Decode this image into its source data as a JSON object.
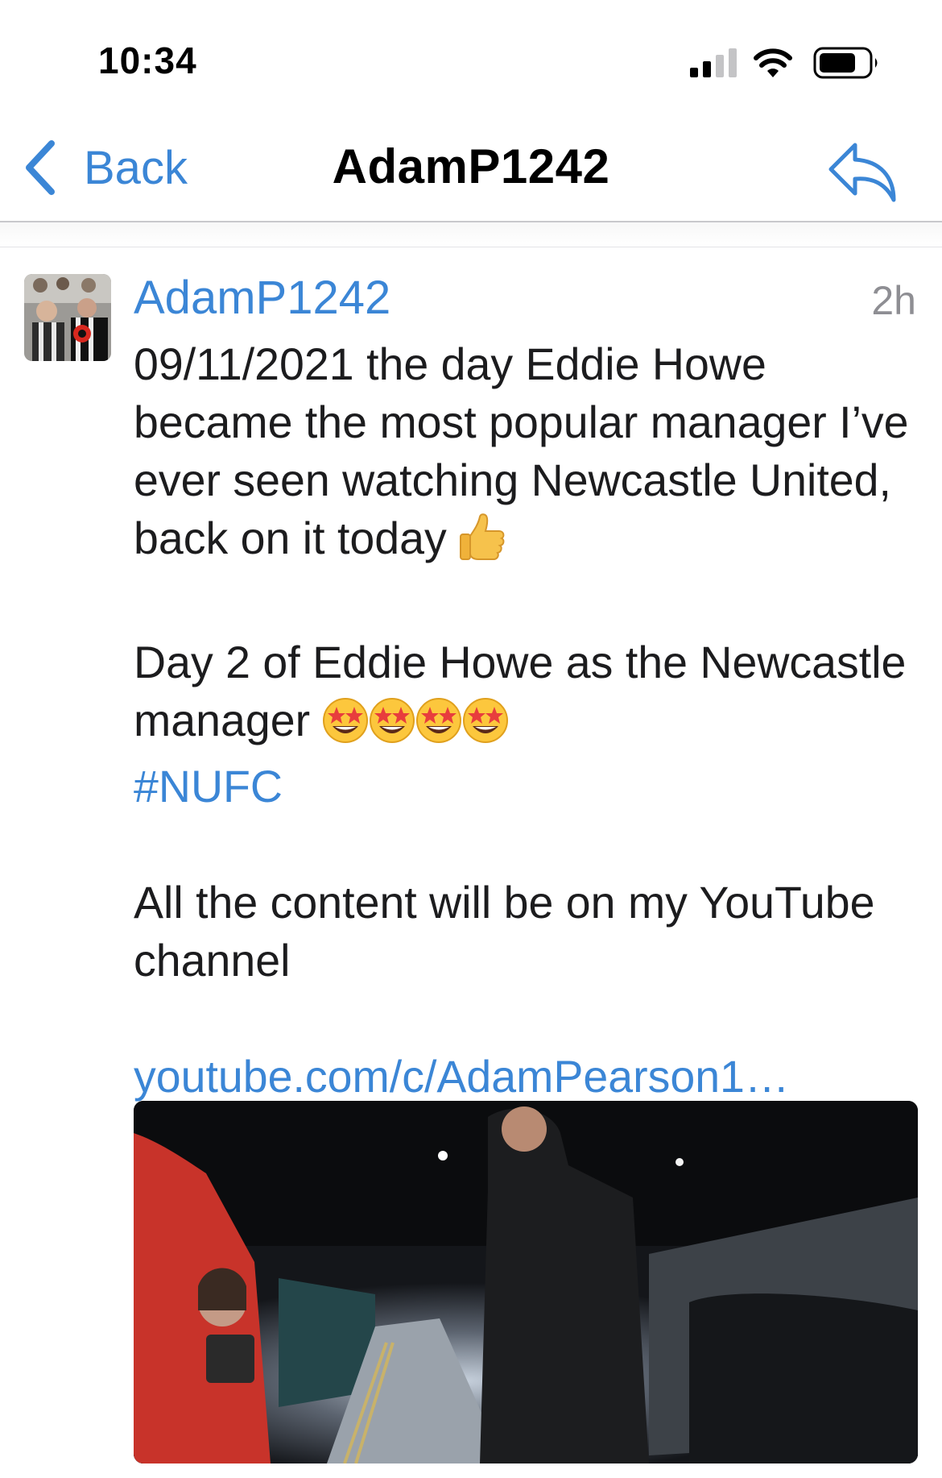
{
  "status_bar": {
    "time": "10:34"
  },
  "nav": {
    "back_label": "Back",
    "title": "AdamP1242",
    "reply_icon": "reply-icon"
  },
  "post": {
    "author": "AdamP1242",
    "time_ago": "2h",
    "paragraph1": "09/11/2021 the day Eddie Howe became the most popular manager I’ve ever seen watching Newcastle United, back on it today",
    "paragraph2": "Day 2 of Eddie Howe as the Newcastle manager",
    "hashtag": "#NUFC",
    "paragraph3": "All the content will be on my YouTube channel",
    "link": "youtube.com/c/AdamPearson1…"
  },
  "colors": {
    "accent": "#3b86d6",
    "secondary_text": "#8e8e93",
    "divider": "#c8c8cc"
  }
}
